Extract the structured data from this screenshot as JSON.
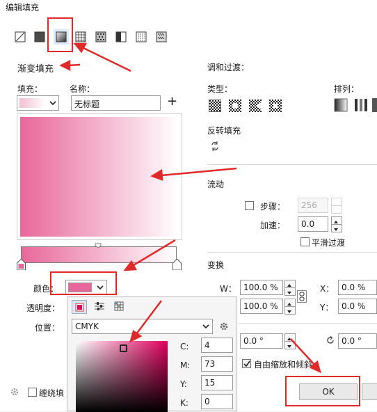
{
  "window": {
    "title": "编辑填充"
  },
  "fill_types": [
    {
      "name": "no-fill-icon",
      "selected": false
    },
    {
      "name": "uniform-fill-icon",
      "selected": false
    },
    {
      "name": "fountain-fill-icon",
      "selected": true
    },
    {
      "name": "vector-pattern-icon",
      "selected": false
    },
    {
      "name": "bitmap-pattern-icon",
      "selected": false
    },
    {
      "name": "two-color-pattern-icon",
      "selected": false
    },
    {
      "name": "texture-fill-icon",
      "selected": false
    },
    {
      "name": "postscript-fill-icon",
      "selected": false
    }
  ],
  "section_title": "渐变填充",
  "fill": {
    "label": "填充：",
    "name_label": "名称：",
    "name_value": "无标题",
    "add_symbol": "+"
  },
  "gradient": {
    "start_color": "#e8679a",
    "end_color": "#ffffff"
  },
  "node": {
    "color_label": "颜色：",
    "color": "#e8679a",
    "transparency_label": "透明度：",
    "position_label": "位置："
  },
  "blend": {
    "title": "调和过渡：",
    "type_label": "类型：",
    "arrange_label": "排列：",
    "reverse_label": "反转填充"
  },
  "flow": {
    "title": "流动",
    "steps_label": "步骤：",
    "steps_value": "256",
    "accel_label": "加速：",
    "accel_value": "0.0",
    "smooth_label": "平滑过渡"
  },
  "transform": {
    "title": "变换",
    "w_label": "W：",
    "w_value": "100.0 %",
    "h_value": "100.0 %",
    "x_label": "X：",
    "x_value": "0.0 %",
    "y_label": "Y：",
    "y_value": "0.0 %",
    "skew_value": "0.0 °",
    "rotate_value": "0.0 °",
    "free_scale_label": "自由缩放和倾斜"
  },
  "color_popup": {
    "model": "CMYK",
    "c_label": "C:",
    "c_value": "4",
    "m_label": "M:",
    "m_value": "73",
    "y_label": "Y:",
    "y_value": "15",
    "k_label": "K:",
    "k_value": "0",
    "hue_color": "#e0005e"
  },
  "footer": {
    "wrap_label": "缠绕填",
    "ok_label": "OK"
  },
  "annotation_color": "#e02a2a"
}
